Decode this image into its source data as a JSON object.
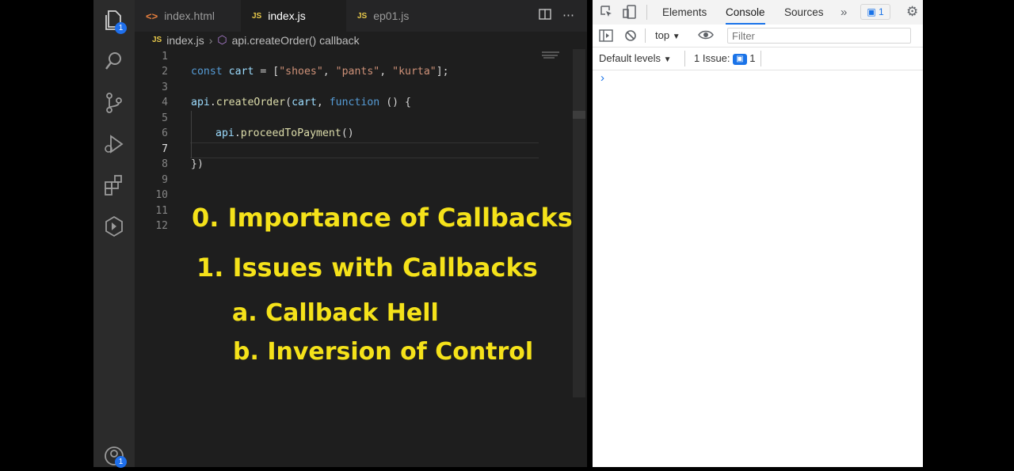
{
  "editor": {
    "tabs": [
      {
        "label": "index.html",
        "type_icon": "html-file-icon"
      },
      {
        "label": "index.js",
        "type_icon": "js-file-icon",
        "active": true,
        "modified": true
      },
      {
        "label": "ep01.js",
        "type_icon": "js-file-icon"
      }
    ],
    "file_badge": "JS",
    "breadcrumb": {
      "file": "index.js",
      "symbol": "api.createOrder() callback"
    },
    "line_numbers": [
      "1",
      "2",
      "3",
      "4",
      "5",
      "6",
      "7",
      "8",
      "9",
      "10",
      "11",
      "12"
    ],
    "code": {
      "line2": {
        "kw": "const",
        "name": "cart",
        "eq": " = [",
        "s1": "\"shoes\"",
        "c1": ", ",
        "s2": "\"pants\"",
        "c2": ", ",
        "s3": "\"kurta\"",
        "end": "];"
      },
      "line4": {
        "obj": "api",
        "dot": ".",
        "fn": "createOrder",
        "open": "(",
        "arg": "cart",
        "comma": ", ",
        "kw": "function",
        "rest": " () {"
      },
      "line6": {
        "obj": "api",
        "dot": ".",
        "fn": "proceedToPayment",
        "rest": "()"
      },
      "line8": "})"
    },
    "activity_badges": {
      "explorer": "1",
      "accounts": "1"
    }
  },
  "overlay": {
    "item0": "0. Importance of Callbacks",
    "item1": "1. Issues with Callbacks",
    "item1a": "a. Callback Hell",
    "item1b": "b. Inversion of Control"
  },
  "devtools": {
    "tabs": [
      "Elements",
      "Console",
      "Sources"
    ],
    "active_tab": "Console",
    "issues_badge_count": "1",
    "context": "top",
    "filter_placeholder": "Filter",
    "levels": "Default levels",
    "issues_label": "1 Issue:",
    "issues_count": "1",
    "prompt": "›"
  },
  "colors": {
    "overlay_text": "#f5e21a",
    "accent": "#1a73e8",
    "editor_bg": "#1e1e1e"
  }
}
